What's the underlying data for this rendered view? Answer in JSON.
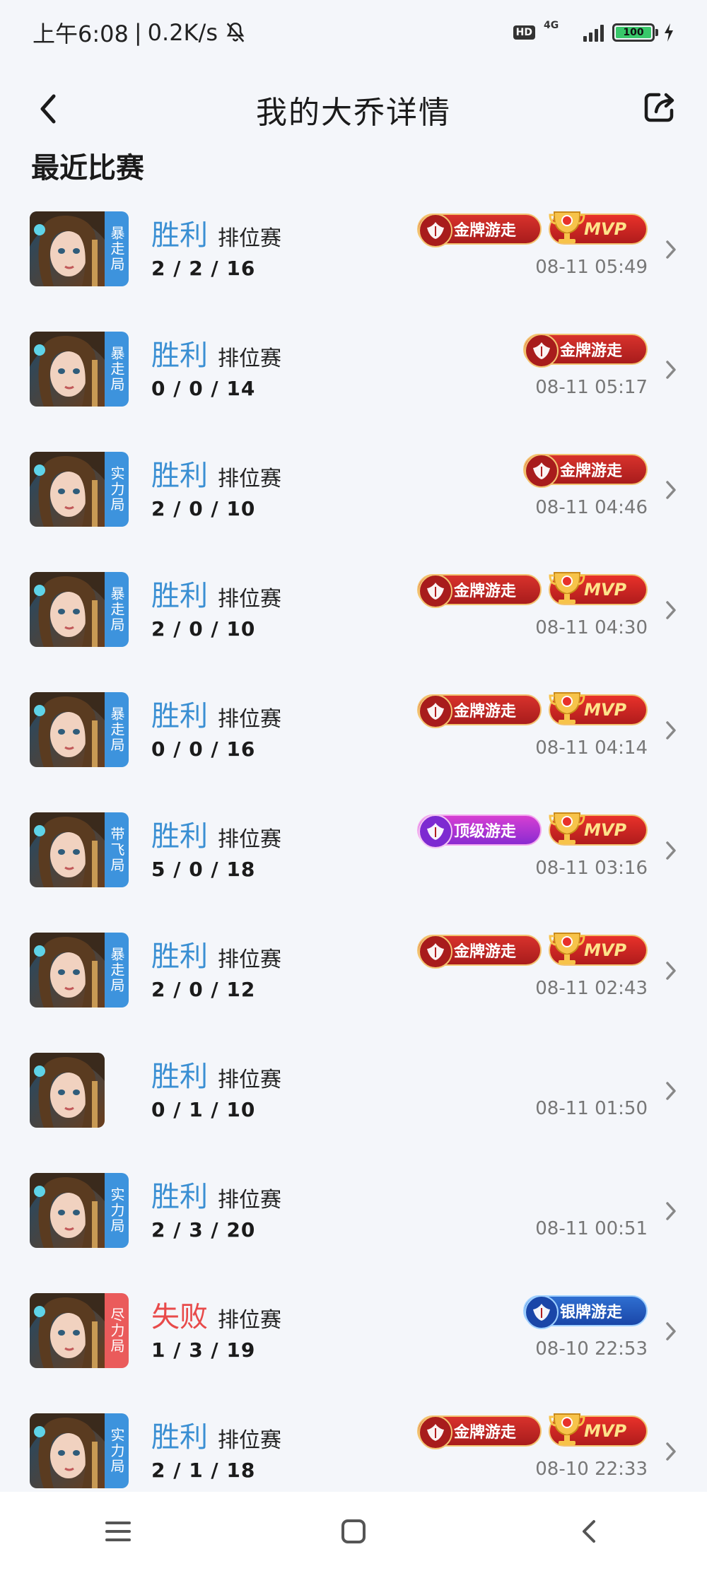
{
  "status_bar": {
    "time": "上午6:08",
    "speed": "0.2K/s",
    "hd": "HD",
    "network": "4G",
    "battery": "100"
  },
  "header": {
    "title": "我的大乔详情"
  },
  "section": {
    "title": "最近比赛"
  },
  "matches": [
    {
      "result": "胜利",
      "mode": "排位赛",
      "kda": "2 / 2 / 16",
      "tag": "暴走局",
      "tag_color": "blue",
      "badges": [
        "gold",
        "mvp"
      ],
      "time": "08-11 05:49"
    },
    {
      "result": "胜利",
      "mode": "排位赛",
      "kda": "0 / 0 / 14",
      "tag": "暴走局",
      "tag_color": "blue",
      "badges": [
        "gold"
      ],
      "time": "08-11 05:17"
    },
    {
      "result": "胜利",
      "mode": "排位赛",
      "kda": "2 / 0 / 10",
      "tag": "实力局",
      "tag_color": "blue",
      "badges": [
        "gold"
      ],
      "time": "08-11 04:46"
    },
    {
      "result": "胜利",
      "mode": "排位赛",
      "kda": "2 / 0 / 10",
      "tag": "暴走局",
      "tag_color": "blue",
      "badges": [
        "gold",
        "mvp"
      ],
      "time": "08-11 04:30"
    },
    {
      "result": "胜利",
      "mode": "排位赛",
      "kda": "0 / 0 / 16",
      "tag": "暴走局",
      "tag_color": "blue",
      "badges": [
        "gold",
        "mvp"
      ],
      "time": "08-11 04:14"
    },
    {
      "result": "胜利",
      "mode": "排位赛",
      "kda": "5 / 0 / 18",
      "tag": "带飞局",
      "tag_color": "blue",
      "badges": [
        "top",
        "mvp"
      ],
      "time": "08-11 03:16"
    },
    {
      "result": "胜利",
      "mode": "排位赛",
      "kda": "2 / 0 / 12",
      "tag": "暴走局",
      "tag_color": "blue",
      "badges": [
        "gold",
        "mvp"
      ],
      "time": "08-11 02:43"
    },
    {
      "result": "胜利",
      "mode": "排位赛",
      "kda": "0 / 1 / 10",
      "tag": "",
      "tag_color": "",
      "badges": [],
      "time": "08-11 01:50"
    },
    {
      "result": "胜利",
      "mode": "排位赛",
      "kda": "2 / 3 / 20",
      "tag": "实力局",
      "tag_color": "blue",
      "badges": [],
      "time": "08-11 00:51"
    },
    {
      "result": "失败",
      "mode": "排位赛",
      "kda": "1 / 3 / 19",
      "tag": "尽力局",
      "tag_color": "red",
      "badges": [
        "silver"
      ],
      "time": "08-10 22:53"
    },
    {
      "result": "胜利",
      "mode": "排位赛",
      "kda": "2 / 1 / 18",
      "tag": "实力局",
      "tag_color": "blue",
      "badges": [
        "gold",
        "mvp"
      ],
      "time": "08-10 22:33"
    }
  ],
  "badge_labels": {
    "gold": "金牌游走",
    "top": "顶级游走",
    "silver": "银牌游走",
    "mvp": "MVP"
  },
  "colors": {
    "win": "#3a8fd3",
    "loss": "#e84a4a",
    "tag_blue": "#3d93dd",
    "tag_red": "#ea5b5b"
  },
  "nav": {
    "menu_icon": "menu-icon",
    "home_icon": "home-icon",
    "back_icon": "back-icon"
  }
}
